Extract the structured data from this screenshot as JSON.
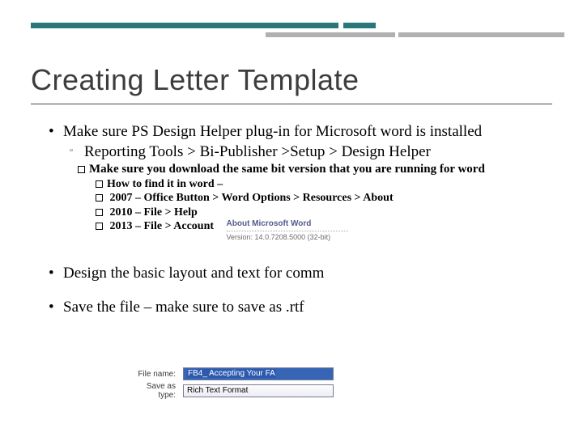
{
  "title": "Creating Letter Template",
  "bullets": {
    "b1": "Make sure PS Design Helper plug-in for Microsoft word is installed",
    "b1_sub": "Reporting Tools > Bi-Publisher >Setup > Design Helper",
    "b1_note": "Make sure you download the same bit version that you are running for word",
    "how0": "How to find it in word –",
    "how1": " 2007 – Office Button > Word Options > Resources > About",
    "how2": " 2010 – File > Help",
    "how3": " 2013 – File > Account",
    "b2": "Design the basic layout and text for comm",
    "b3": "Save the file – make sure to save as .rtf"
  },
  "aboutword": {
    "heading": "About Microsoft Word",
    "version": "Version: 14.0.7208.5000 (32-bit)"
  },
  "saveas": {
    "filename_label": "File name:",
    "filename_value": "FB4_ Accepting Your FA",
    "type_label": "Save as type:",
    "type_value": "Rich Text Format"
  }
}
